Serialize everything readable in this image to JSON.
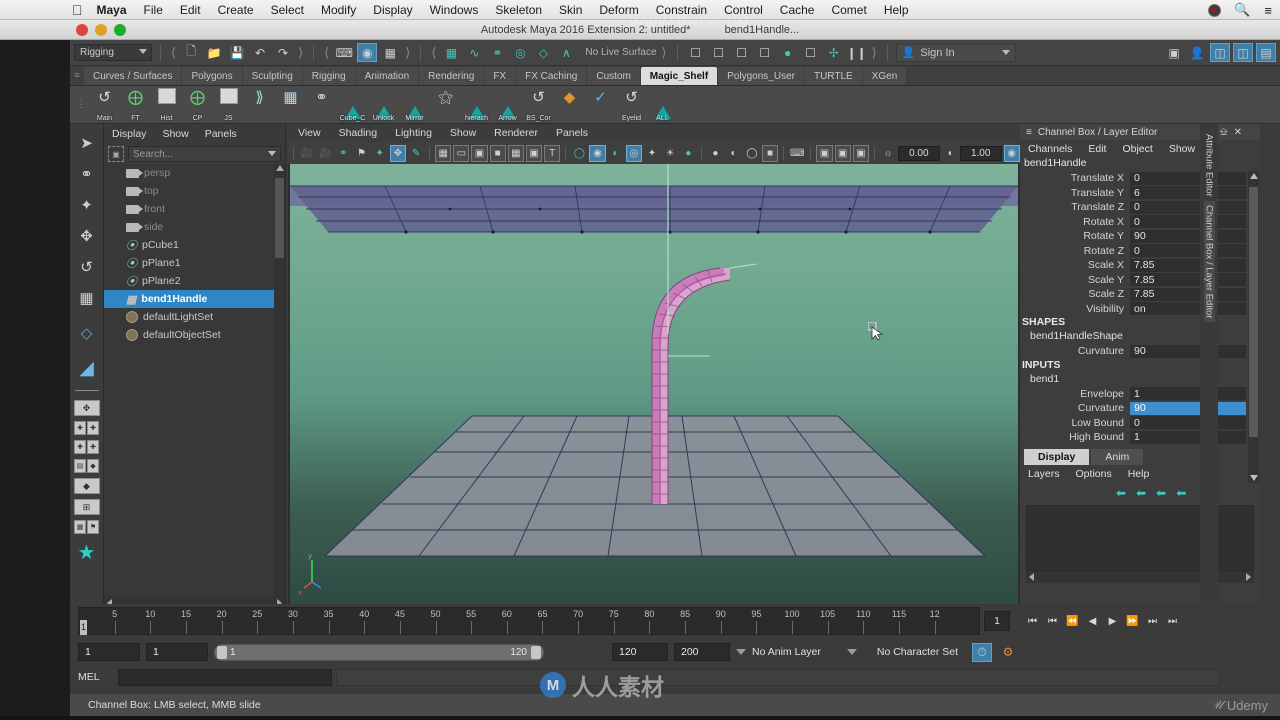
{
  "os_menu": {
    "apple_icon": "apple-icon",
    "items": [
      "Maya",
      "File",
      "Edit",
      "Create",
      "Select",
      "Modify",
      "Display",
      "Windows",
      "Skeleton",
      "Skin",
      "Deform",
      "Constrain",
      "Control",
      "Cache",
      "Comet",
      "Help"
    ],
    "right_icons": [
      "record-icon",
      "search-icon",
      "list-icon"
    ]
  },
  "title_bar": {
    "title": "Autodesk Maya 2016 Extension 2: untitled*",
    "subtitle": "bend1Handle...",
    "traffic_lights": [
      "close-button",
      "minimize-button",
      "zoom-button"
    ]
  },
  "status_line": {
    "menu_set": "Rigging",
    "file_icons": [
      "new-scene-icon",
      "open-scene-icon",
      "save-scene-icon",
      "undo-icon",
      "redo-icon"
    ],
    "select_mode_icons": [
      "select-hierarchy-icon",
      "select-object-icon",
      "select-component-icon"
    ],
    "snap_icons": [
      "snap-to-grid-icon",
      "snap-to-curve-icon",
      "snap-to-point-icon",
      "snap-to-projected-center-icon",
      "snap-to-view-plane-icon",
      "make-live-icon"
    ],
    "live_surface": "No Live Surface",
    "history_icons": [
      "construction-history-icon",
      "render-icon",
      "ipr-render-icon",
      "render-settings-icon",
      "hypershade-icon",
      "render-view-icon",
      "render-setup-icon",
      "pause-icon"
    ],
    "sign_in": "Sign In",
    "right_icons": [
      "hide-ui-icon",
      "character-icon",
      "attribute-editor-icon",
      "tool-settings-icon",
      "channel-box-icon"
    ]
  },
  "shelf": {
    "tabs": [
      "Curves / Surfaces",
      "Polygons",
      "Sculpting",
      "Rigging",
      "Animation",
      "Rendering",
      "FX",
      "FX Caching",
      "Custom",
      "Magic_Shelf",
      "Polygons_User",
      "TURTLE",
      "XGen"
    ],
    "active_tab": "Magic_Shelf",
    "buttons": [
      {
        "label": "Main",
        "icon": "rotate-arrow-icon"
      },
      {
        "label": "FT",
        "icon": "axis-icon"
      },
      {
        "label": "Hist",
        "icon": "edit-note-icon"
      },
      {
        "label": "CP",
        "icon": "axis-icon"
      },
      {
        "label": "JS",
        "icon": "globe-icon"
      },
      {
        "label": "",
        "icon": "joint-chain-icon"
      },
      {
        "label": "",
        "icon": "lattice-icon"
      },
      {
        "label": "",
        "icon": "hand-select-icon"
      },
      {
        "label": "Cube_C",
        "icon": "teal-house-icon"
      },
      {
        "label": "Unlock",
        "icon": "teal-house-icon"
      },
      {
        "label": "Mirror",
        "icon": "teal-house-icon"
      },
      {
        "label": "",
        "icon": "sphere-lattice-icon"
      },
      {
        "label": "hierach",
        "icon": "teal-house-icon"
      },
      {
        "label": "Arrow",
        "icon": "teal-house-icon"
      },
      {
        "label": "BS_Cor",
        "icon": "rotate-arrow-icon"
      },
      {
        "label": "",
        "icon": "orange-diamond-icon"
      },
      {
        "label": "",
        "icon": "paint-brush-icon"
      },
      {
        "label": "Eyelid",
        "icon": "rotate-arrow-icon"
      },
      {
        "label": "ALL",
        "icon": "teal-house-icon"
      }
    ]
  },
  "toolbox": {
    "tools": [
      "select-tool",
      "lasso-select-tool",
      "paint-select-tool",
      "move-tool",
      "rotate-tool",
      "scale-tool",
      "last-tool-icon",
      "show-manipulator-tool"
    ],
    "layout_presets": [
      "single-perspective-layout",
      "four-view-layout",
      "two-pane-stacked-layout",
      "outliner-persp-layout",
      "hypergraph-layout",
      "persp-graph-layout",
      "bookmark-layout"
    ]
  },
  "outliner": {
    "menu": [
      "Display",
      "Show",
      "Panels"
    ],
    "search_placeholder": "Search...",
    "items": [
      {
        "name": "persp",
        "type": "camera",
        "dim": true,
        "selected": false
      },
      {
        "name": "top",
        "type": "camera",
        "dim": true,
        "selected": false
      },
      {
        "name": "front",
        "type": "camera",
        "dim": true,
        "selected": false
      },
      {
        "name": "side",
        "type": "camera",
        "dim": true,
        "selected": false
      },
      {
        "name": "pCube1",
        "type": "mesh",
        "dim": false,
        "selected": false
      },
      {
        "name": "pPlane1",
        "type": "mesh",
        "dim": false,
        "selected": false
      },
      {
        "name": "pPlane2",
        "type": "mesh",
        "dim": false,
        "selected": false
      },
      {
        "name": "bend1Handle",
        "type": "deformer",
        "dim": false,
        "selected": true
      },
      {
        "name": "defaultLightSet",
        "type": "set",
        "dim": false,
        "selected": false
      },
      {
        "name": "defaultObjectSet",
        "type": "set",
        "dim": false,
        "selected": false
      }
    ]
  },
  "viewport": {
    "menu": [
      "View",
      "Shading",
      "Lighting",
      "Show",
      "Renderer",
      "Panels"
    ],
    "toolbar_icons": [
      "camera-icon",
      "camera-attributes-icon",
      "bookmark-camera-icon",
      "image-plane-icon",
      "paint-effects-icon",
      "two-d-pan-zoom-icon",
      "grease-pencil-icon",
      "grid-icon",
      "film-gate-icon",
      "resolution-gate-icon",
      "gate-mask-icon",
      "field-chart-icon",
      "safe-action-icon",
      "safe-title-icon",
      "wireframe-icon",
      "smooth-shade-icon",
      "smooth-shade-all-icon",
      "shaded-wireframe-icon",
      "hardware-texture-icon",
      "use-all-lights-icon",
      "shadows-icon",
      "screen-space-ao-icon",
      "motion-blur-icon",
      "multisample-icon",
      "depth-of-field-icon",
      "isolate-select-icon",
      "xray-icon",
      "xray-joints-icon",
      "xray-active-components-icon",
      "exposure-icon",
      "gamma-icon",
      "color-management-icon"
    ],
    "exposure_value": "0.00",
    "gamma_value": "1.00"
  },
  "channel_box": {
    "panel_title": "Channel Box / Layer Editor",
    "panel_icons": [
      "undock-icon",
      "close-icon"
    ],
    "menu": [
      "Channels",
      "Edit",
      "Object",
      "Show"
    ],
    "object_name": "bend1Handle",
    "transform_attrs": [
      {
        "label": "Translate X",
        "value": "0",
        "selected": false
      },
      {
        "label": "Translate Y",
        "value": "6",
        "selected": false
      },
      {
        "label": "Translate Z",
        "value": "0",
        "selected": false
      },
      {
        "label": "Rotate X",
        "value": "0",
        "selected": false
      },
      {
        "label": "Rotate Y",
        "value": "90",
        "selected": false
      },
      {
        "label": "Rotate Z",
        "value": "0",
        "selected": false
      },
      {
        "label": "Scale X",
        "value": "7.85",
        "selected": false
      },
      {
        "label": "Scale Y",
        "value": "7.85",
        "selected": false
      },
      {
        "label": "Scale Z",
        "value": "7.85",
        "selected": false
      },
      {
        "label": "Visibility",
        "value": "on",
        "selected": false
      }
    ],
    "shapes_header": "SHAPES",
    "shape_name": "bend1HandleShape",
    "shape_attrs": [
      {
        "label": "Curvature",
        "value": "90",
        "selected": false
      }
    ],
    "inputs_header": "INPUTS",
    "input_name": "bend1",
    "input_attrs": [
      {
        "label": "Envelope",
        "value": "1",
        "selected": false
      },
      {
        "label": "Curvature",
        "value": "90",
        "selected": true
      },
      {
        "label": "Low Bound",
        "value": "0",
        "selected": false
      },
      {
        "label": "High Bound",
        "value": "1",
        "selected": false
      }
    ],
    "selected_color": "#3f8fd0"
  },
  "layer_editor": {
    "tabs": [
      "Display",
      "Anim"
    ],
    "active_tab": "Display",
    "menu": [
      "Layers",
      "Options",
      "Help"
    ],
    "buttons": [
      "new-layer-icon",
      "new-layer-from-selected-icon",
      "layer-prev-icon",
      "layer-next-icon"
    ]
  },
  "dock_tabs": {
    "items": [
      "Attribute Editor",
      "Channel Box / Layer Editor"
    ],
    "active": "Channel Box / Layer Editor"
  },
  "time_slider": {
    "tick_labels": [
      "5",
      "10",
      "15",
      "20",
      "25",
      "30",
      "35",
      "40",
      "45",
      "50",
      "55",
      "60",
      "65",
      "70",
      "75",
      "80",
      "85",
      "90",
      "95",
      "100",
      "105",
      "110",
      "115",
      "12"
    ],
    "current_frame": "1",
    "current_frame_box": "1",
    "playback_icons": [
      "go-to-start-icon",
      "step-back-key-icon",
      "step-back-frame-icon",
      "play-backwards-icon",
      "play-forwards-icon",
      "step-forward-frame-icon",
      "step-forward-key-icon",
      "go-to-end-icon"
    ]
  },
  "range_slider": {
    "start_time": "1",
    "playback_start": "1",
    "range_start_label": "1",
    "range_end_label": "120",
    "playback_end": "120",
    "end_time": "200",
    "anim_layer": "No Anim Layer",
    "character_set": "No Character Set",
    "right_icons": [
      "auto-keyframe-icon",
      "animation-preferences-icon"
    ]
  },
  "command_line": {
    "language": "MEL",
    "input_value": "",
    "output_value": ""
  },
  "help_line": {
    "text": "Channel Box: LMB select, MMB slide"
  },
  "branding": {
    "udemy": "Udemy",
    "watermark_url": "WWW.RRCG.CN",
    "watermark_site": "人人素材"
  }
}
